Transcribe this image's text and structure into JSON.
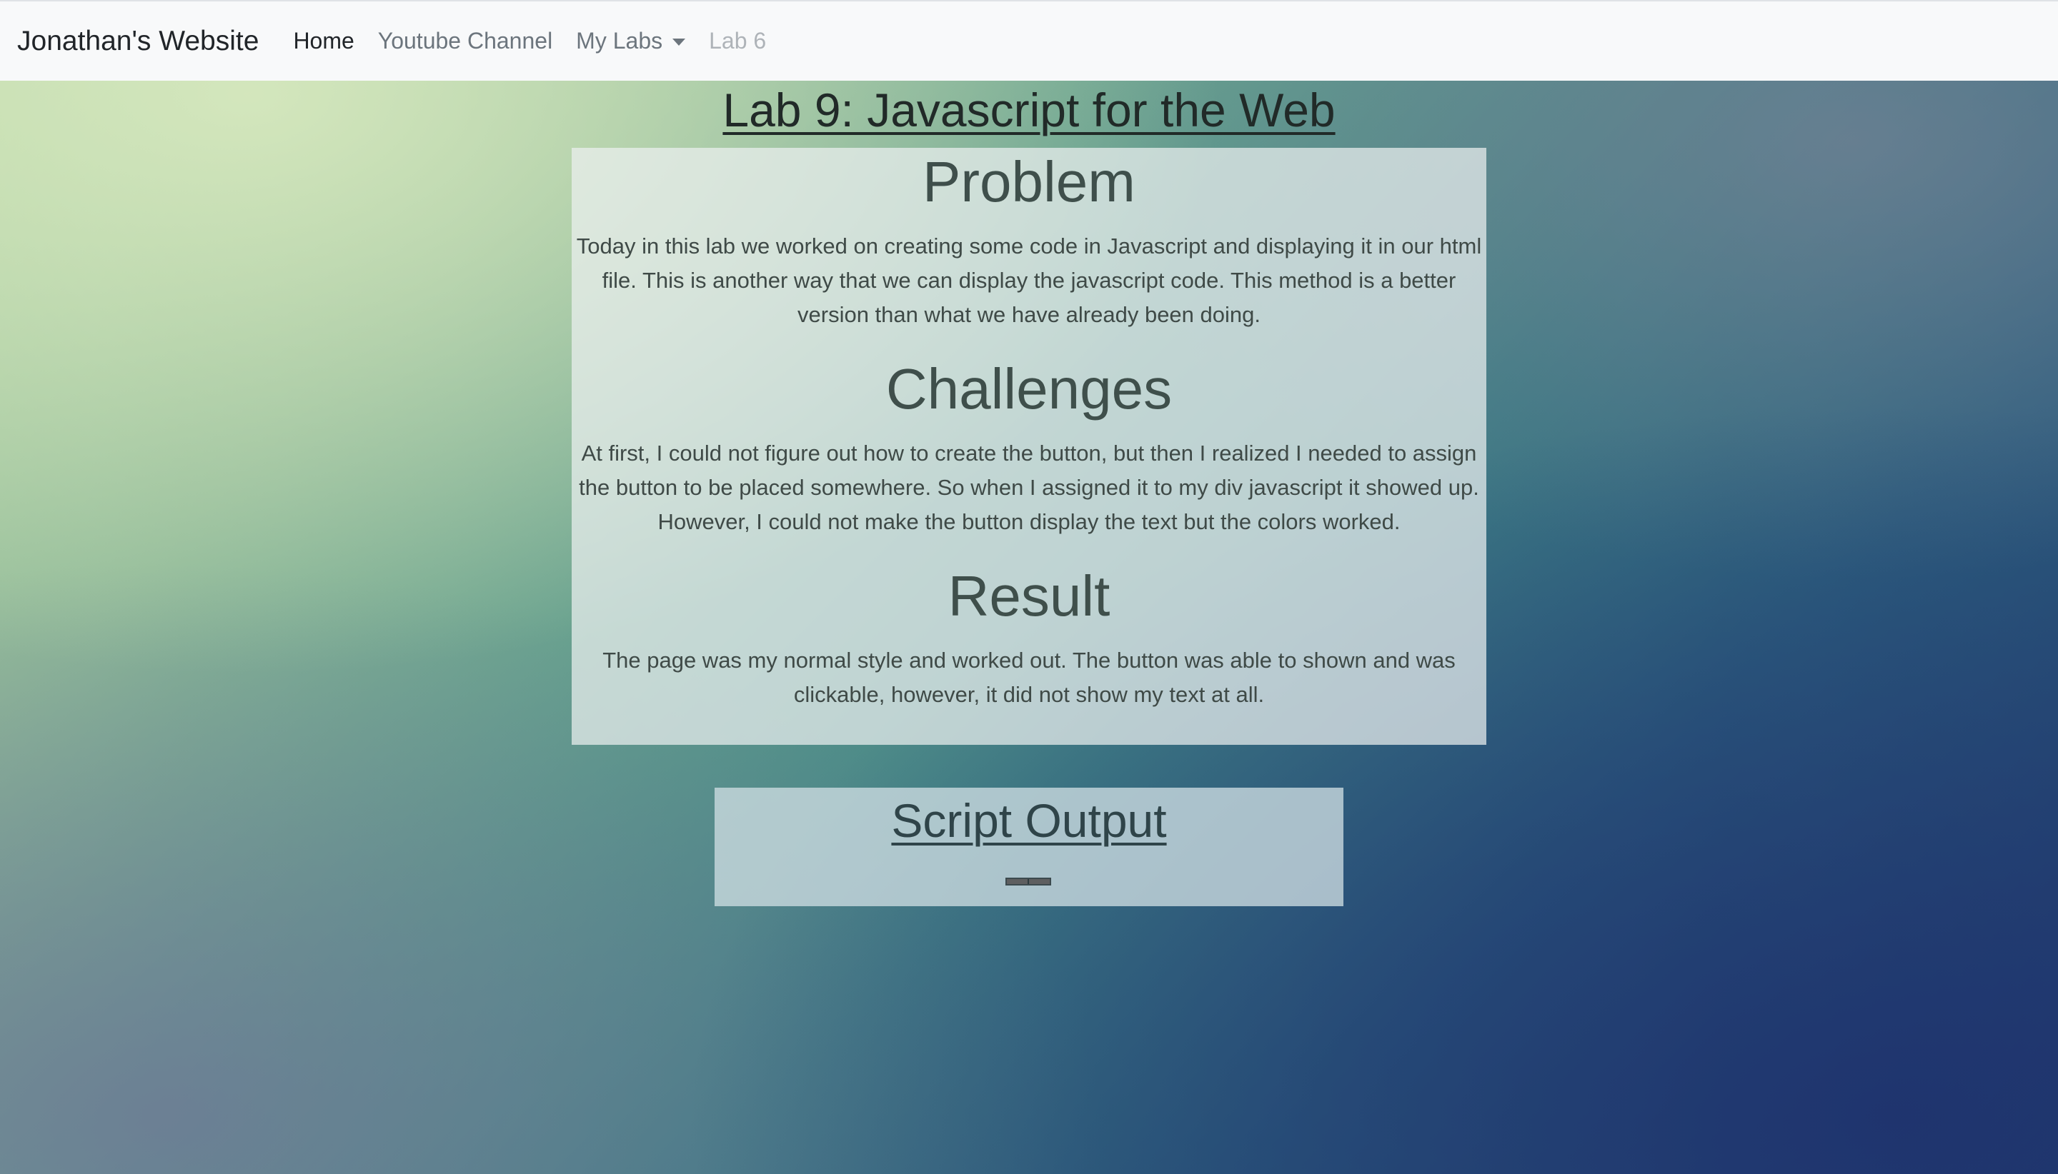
{
  "navbar": {
    "brand": "Jonathan's Website",
    "links": [
      {
        "label": "Home"
      },
      {
        "label": "Youtube Channel"
      },
      {
        "label": "My Labs"
      },
      {
        "label": "Lab 6"
      }
    ]
  },
  "page": {
    "title": "Lab 9: Javascript for the Web"
  },
  "sections": [
    {
      "heading": "Problem",
      "text": "Today in this lab we worked on creating some code in Javascript and displaying it in our html file. This is another way that we can display the javascript code. This method is a better version than what we have already been doing."
    },
    {
      "heading": "Challenges",
      "text": "At first, I could not figure out how to create the button, but then I realized I needed to assign the button to be placed somewhere. So when I assigned it to my div javascript it showed up. However, I could not make the button display the text but the colors worked."
    },
    {
      "heading": "Result",
      "text": "The page was my normal style and worked out. The button was able to shown and was clickable, however, it did not show my text at all."
    }
  ],
  "output": {
    "title": "Script Output"
  }
}
